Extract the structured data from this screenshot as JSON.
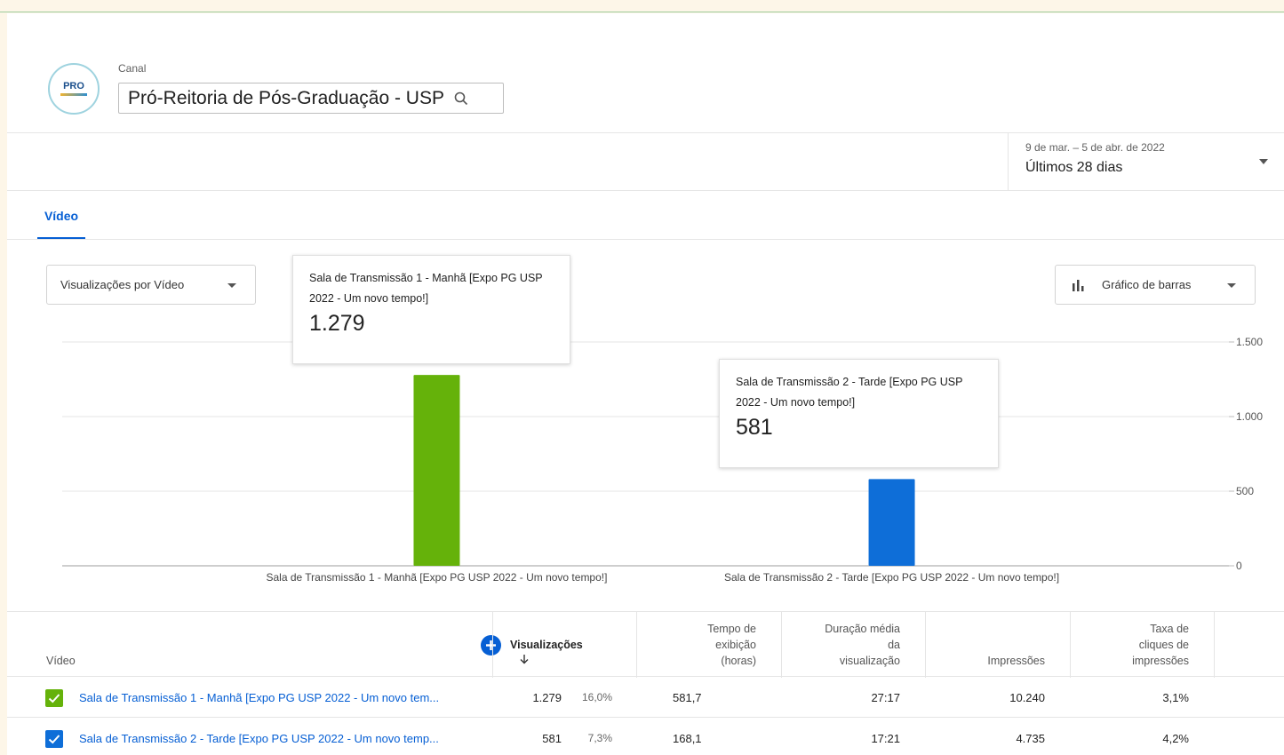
{
  "header": {
    "channel_label": "Canal",
    "channel_name": "Pró-Reitoria de Pós-Graduação - USP",
    "avatar_text": "PRO"
  },
  "date_filter": {
    "range": "9 de mar. – 5 de abr. de 2022",
    "period": "Últimos 28 dias"
  },
  "tabs": [
    {
      "label": "Vídeo",
      "active": true
    }
  ],
  "controls": {
    "metric_dropdown": "Visualizações por Vídeo",
    "chart_type_dropdown": "Gráfico de barras"
  },
  "tooltips": [
    {
      "title": "Sala de Transmissão 1 - Manhã [Expo PG USP 2022 - Um novo tempo!]",
      "value": "1.279"
    },
    {
      "title": "Sala de Transmissão 2 - Tarde [Expo PG USP 2022 - Um novo tempo!]",
      "value": "581"
    }
  ],
  "chart_data": {
    "type": "bar",
    "categories": [
      "Sala de Transmissão 1 - Manhã [Expo PG USP 2022 - Um novo tempo!]",
      "Sala de Transmissão 2 - Tarde [Expo PG USP 2022 - Um novo tempo!]"
    ],
    "values": [
      1279,
      581
    ],
    "colors": [
      "#65b20a",
      "#0e6ed8"
    ],
    "ylim": [
      0,
      1500
    ],
    "yticks": [
      0,
      500,
      1000,
      1500
    ],
    "ytick_labels": [
      "0",
      "500",
      "1.000",
      "1.500"
    ],
    "grid": true,
    "y_axis_side": "right"
  },
  "table": {
    "headers": {
      "video": "Vídeo",
      "views": "Visualizações",
      "watch_time": [
        "Tempo de",
        "exibição",
        "(horas)"
      ],
      "avg_duration": [
        "Duração média",
        "da",
        "visualização"
      ],
      "impressions": "Impressões",
      "ctr": [
        "Taxa de",
        "cliques de",
        "impressões"
      ]
    },
    "rows": [
      {
        "title": "Sala de Transmissão 1 - Manhã [Expo PG USP 2022 - Um novo tem...",
        "views": "1.279",
        "views_pct": "16,0%",
        "watch_time": "581,7",
        "avg_duration": "27:17",
        "impressions": "10.240",
        "ctr": "3,1%",
        "checkbox_color": "#65b20a"
      },
      {
        "title": "Sala de Transmissão 2 - Tarde [Expo PG USP 2022 - Um novo temp...",
        "views": "581",
        "views_pct": "7,3%",
        "watch_time": "168,1",
        "avg_duration": "17:21",
        "impressions": "4.735",
        "ctr": "4,2%",
        "checkbox_color": "#0e6ed8"
      }
    ]
  },
  "icons": {
    "search": "search-icon",
    "caret": "chevron-down-icon",
    "bar_chart": "bar-chart-icon",
    "add": "add-column-icon",
    "sort": "arrow-down-icon",
    "check": "check-icon"
  }
}
